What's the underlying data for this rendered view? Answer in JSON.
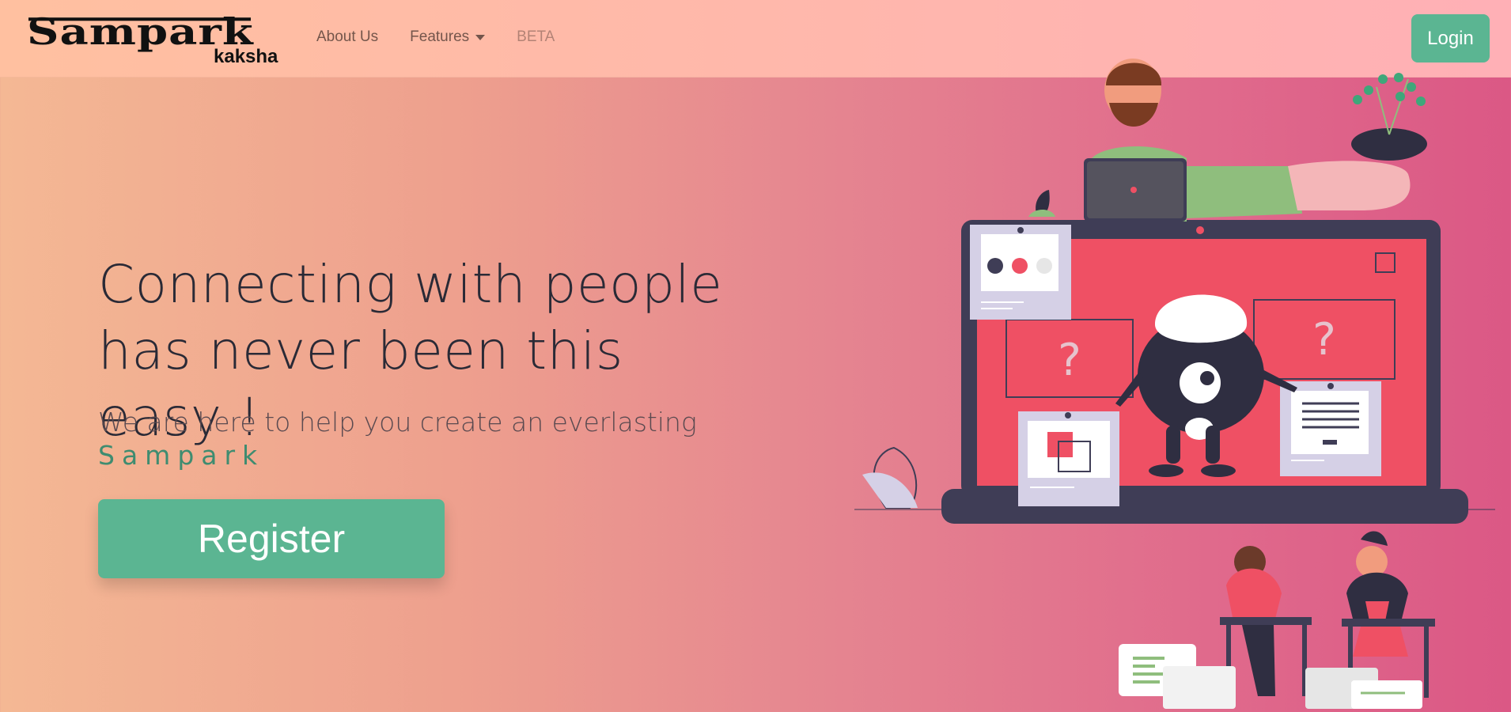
{
  "navbar": {
    "brand": {
      "logo_text": "Sampark",
      "sub_text": "kaksha"
    },
    "links": [
      {
        "label": "About Us"
      },
      {
        "label": "Features"
      },
      {
        "label": "BETA"
      }
    ],
    "login_label": "Login"
  },
  "hero": {
    "title_line1": "Connecting with people",
    "title_line2": "has never been this easy !",
    "subtitle": "We are here to help you create an everlasting",
    "brand_word": "Sampark",
    "register_label": "Register"
  },
  "colors": {
    "accent": "#5bb592",
    "brand_text": "#3f8c70",
    "screen": "#ef5064",
    "laptop_frame": "#3f3d56"
  },
  "illustration": {
    "question_mark": "?"
  }
}
